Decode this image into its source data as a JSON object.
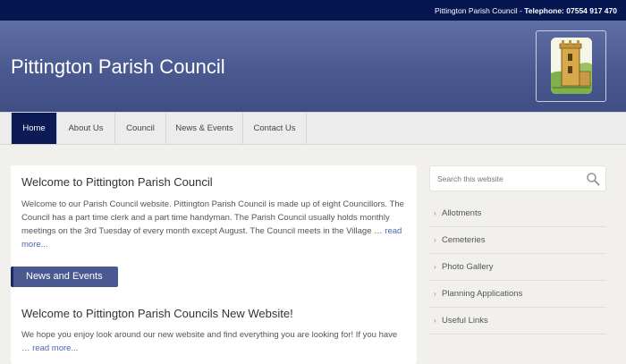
{
  "topbar": {
    "org": "Pittington Parish Council - ",
    "phone_label": "Telephone:",
    "phone": " 07554 917 470"
  },
  "header": {
    "site_title": "Pittington Parish Council"
  },
  "nav": [
    {
      "label": "Home"
    },
    {
      "label": "About Us"
    },
    {
      "label": "Council"
    },
    {
      "label": "News & Events"
    },
    {
      "label": "Contact Us"
    }
  ],
  "main": {
    "post1": {
      "title": "Welcome to Pittington Parish Council",
      "body": "Welcome to our Parish Council website. Pittington Parish Council is made up of eight Councillors. The Council has a part time clerk and a part time handyman. The Parish Council usually holds monthly meetings on the 3rd Tuesday of every month except August. The Council meets in the Village … ",
      "more": "read more..."
    },
    "section_label": "News and Events",
    "post2": {
      "title": "Welcome to Pittington Parish Councils New Website!",
      "body": "We hope you enjoy look around our new website and find everything you are looking for! If you have … ",
      "more": "read more..."
    }
  },
  "search": {
    "placeholder": "Search this website"
  },
  "sidebar": {
    "bullet": "›",
    "items": [
      {
        "label": "Allotments"
      },
      {
        "label": "Cemeteries"
      },
      {
        "label": "Photo Gallery"
      },
      {
        "label": "Planning Applications"
      },
      {
        "label": "Useful Links"
      }
    ]
  },
  "colors": {
    "topbar": "#061650",
    "header": "#4a5990",
    "nav_active": "#0c1b55",
    "link": "#4a67b0"
  }
}
